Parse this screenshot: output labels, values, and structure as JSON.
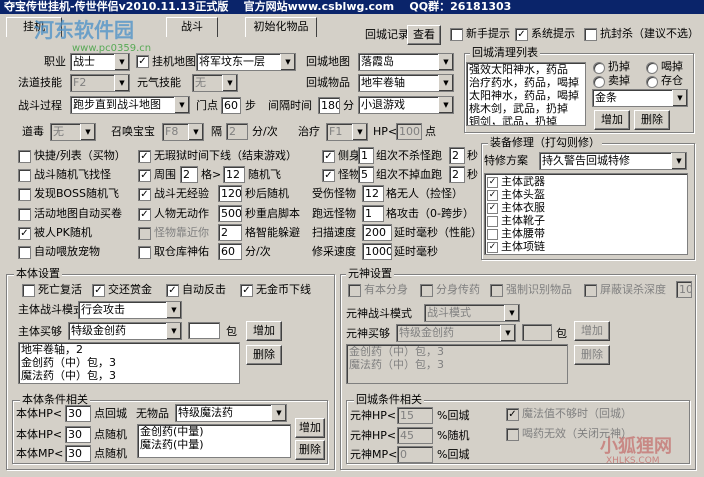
{
  "title": "夺宝传世挂机-传世伴侣v2010.11.13正式版    官方网站www.csblwg.com    QQ群：26181303",
  "tabs": [
    "挂机",
    "战斗",
    "初始化物品"
  ],
  "watermark": {
    "text1": "河东软件园",
    "text2": "www.pc0359.cn",
    "text3": "小狐狸网",
    "text4": "XHLKS.COM"
  },
  "top": {
    "huicheng_jilu": "回城记录",
    "chakan": "查看",
    "xinshou_tishi": "新手提示",
    "xitong_tishi": "系统提示",
    "kangcaisha": "抗封杀（建议不选）"
  },
  "left_top": {
    "zhiye_label": "职业",
    "zhiye_value": "战士",
    "guaji_ditu_label": "挂机地图",
    "guaji_ditu_value": "将军坟东一层",
    "fadao_label": "法道技能",
    "fadao_value": "F2",
    "yuanqi_label": "元气技能",
    "yuanqi_value": "无",
    "zhandou_label": "战斗过程",
    "zhandou_value": "跑步直到战斗地图",
    "mendian_label": "门点",
    "mendian_value": "60",
    "bu": "步",
    "daodu_label": "道毒",
    "daodu_value": "无",
    "zhaohuan_label": "召唤宝宝",
    "zhaohuan_value": "F8",
    "ge_label": "隔",
    "ge_value": "2",
    "fenci": "分/次",
    "zhiliao_label": "治疗",
    "zhiliao_value": "F1",
    "hp_label": "HP<",
    "hp_value": "100",
    "dian": "点"
  },
  "huicheng": {
    "map_label": "回城地图",
    "map_value": "落霞岛",
    "item_label": "回城物品",
    "item_value": "地牢卷轴",
    "interval_label": "间隔时间",
    "interval_value": "180",
    "fen": "分",
    "game_value": "小退游戏"
  },
  "clean": {
    "title": "回城清理列表",
    "items": [
      "强效太阳神水，药品",
      "治疗药水，药品，喝掉",
      "太阳神水，药品，喝掉",
      "桃木剑，武品，扔掉",
      "铜剑，武品，扔掉"
    ],
    "radio": [
      "扔掉",
      "喝掉",
      "卖掉",
      "存仓"
    ],
    "gold": "金条",
    "add": "增加",
    "del": "删除"
  },
  "checks_left": [
    {
      "label": "快捷/列表（买物）",
      "checked": false
    },
    {
      "label": "战斗随机飞找怪",
      "checked": false
    },
    {
      "label": "发现BOSS随机飞",
      "checked": false
    },
    {
      "label": "活动地图自动买卷",
      "checked": false
    },
    {
      "label": "被人PK随机",
      "checked": true
    },
    {
      "label": "自动喂放宠物",
      "checked": false
    }
  ],
  "mid": {
    "wuhun": "无瑕狱时间下线（结束游戏）",
    "zhouwei": "周围",
    "zhouwei_v": "2",
    "gewei": "格>",
    "gewei_v": "12",
    "suijifei": "随机飞",
    "wujingyan": "战斗无经验",
    "wujingyan_v": "120",
    "miaohou": "秒后随机",
    "renwu": "人物无动作",
    "renwu_v": "500",
    "chongqi": "秒重启脚本",
    "guaiwu_jinxing": "怪物靠近你",
    "guaiwu_v": "2",
    "zhineng": "格智能躲避",
    "quchu": "取仓库神佑",
    "quchu_v": "60",
    "fenci": "分/次"
  },
  "right_mid": {
    "cefang": "侧身",
    "cefang_v": "1",
    "cefang_t": "组次不杀怪跑",
    "cefang_v2": "2",
    "miao": "秒",
    "guaiwu": "怪物",
    "guaiwu_v": "5",
    "guaiwu_t": "组次不掉血跑",
    "guaiwu_v2": "2",
    "shougong": "受伤怪物",
    "shougong_v": "12",
    "shougong_t": "格无人（捡怪）",
    "paoyuan": "跑远怪物",
    "paoyuan_v": "1",
    "paoyuan_t": "格攻击（0-跨步）",
    "saomiao": "扫描速度",
    "saomiao_v": "200",
    "saomiao_t": "延时毫秒（性能）",
    "xiuxi": "修采速度",
    "xiuxi_v": "1000",
    "xiuxi_t": "延时毫秒"
  },
  "equip": {
    "title": "装备修理（打勾则修）",
    "fang_label": "特修方案",
    "fang_value": "持久警告回城特修",
    "items": [
      {
        "label": "主体武器",
        "checked": true
      },
      {
        "label": "主体头盔",
        "checked": true
      },
      {
        "label": "主体衣服",
        "checked": true
      },
      {
        "label": "主体靴子",
        "checked": false
      },
      {
        "label": "主体腰带",
        "checked": false
      },
      {
        "label": "主体项链",
        "checked": true
      }
    ]
  },
  "benti": {
    "title": "本体设置",
    "checks": [
      {
        "label": "死亡复活",
        "checked": false
      },
      {
        "label": "交还赏金",
        "checked": true
      },
      {
        "label": "自动反击",
        "checked": true
      },
      {
        "label": "无金币下线",
        "checked": true
      }
    ],
    "mode_label": "主体战斗模式",
    "mode_value": "行会攻击",
    "buy_label": "主体买够",
    "buy_value": "特级金创药",
    "bao": "包",
    "add": "增加",
    "del": "删除",
    "list": [
      "地牢卷轴，2",
      "金创药（中）包，3",
      "魔法药（中）包，3"
    ]
  },
  "benti_cond": {
    "title": "本体条件相关",
    "hp1_label": "本体HP<",
    "hp1_value": "30",
    "hp1_t": "点回城",
    "wupin_label": "无物品",
    "wupin_value": "特级魔法药",
    "hp2_label": "本体HP<",
    "hp2_value": "30",
    "hp2_t": "点随机",
    "mp_label": "本体MP<",
    "mp_value": "30",
    "mp_t": "点随机",
    "list": [
      "金创药(中量)",
      "魔法药(中量)"
    ],
    "add": "增加",
    "del": "删除"
  },
  "yuanshen": {
    "title": "元神设置",
    "checks": [
      {
        "label": "有本分身",
        "checked": false
      },
      {
        "label": "分身传药",
        "checked": false
      },
      {
        "label": "强制识别物品",
        "checked": false
      },
      {
        "label": "屏蔽误杀深度",
        "checked": false
      }
    ],
    "depth": "10",
    "mode_label": "元神战斗模式",
    "mode_value": "战斗模式",
    "buy_label": "元神买够",
    "buy_value": "特级金创药",
    "bao": "包",
    "add": "增加",
    "del": "删除",
    "list": [
      "金创药（中）包，3",
      "魔法药（中）包，3"
    ]
  },
  "yuanshen_cond": {
    "title": "回城条件相关",
    "hp1_label": "元神HP<",
    "hp1_value": "15",
    "hp1_t": "%回城",
    "hp2_label": "元神HP<",
    "hp2_value": "45",
    "hp2_t": "%随机",
    "mp_label": "元神MP<",
    "mp_value": "0",
    "mp_t": "%回城",
    "c1": "魔法值不够时（回城）",
    "c2": "喝药无效（关闭元神）"
  }
}
